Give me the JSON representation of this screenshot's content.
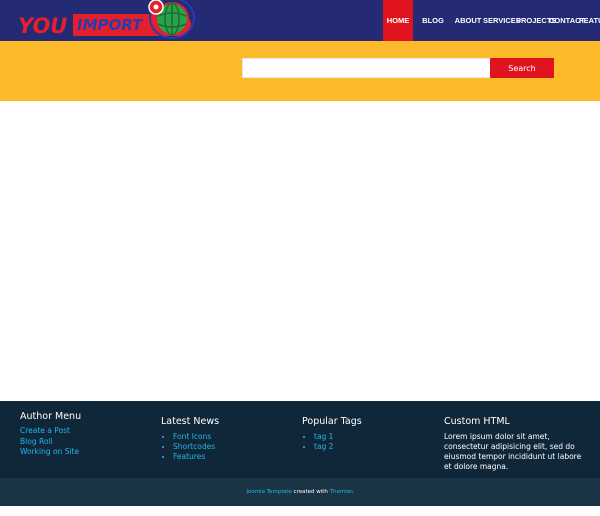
{
  "logo": {
    "part1": "YOU",
    "part2": "IMPORT"
  },
  "nav": {
    "items": [
      {
        "label": "HOME",
        "active": true
      },
      {
        "label": "BLOG"
      },
      {
        "label": "ABOUT"
      },
      {
        "label": "SERVICES"
      },
      {
        "label": "PROJECTS"
      },
      {
        "label": "CONTACT"
      },
      {
        "label": "FEATU"
      }
    ]
  },
  "search": {
    "value": "",
    "button_label": "Search"
  },
  "footer": {
    "author_menu": {
      "title": "Author Menu",
      "links": [
        "Create a Post",
        "Blog Roll",
        "Working on Site"
      ]
    },
    "latest_news": {
      "title": "Latest News",
      "items": [
        "Font Icons",
        "Shortcodes",
        "Features"
      ]
    },
    "popular_tags": {
      "title": "Popular Tags",
      "items": [
        "tag 1",
        "tag 2"
      ]
    },
    "custom_html": {
      "title": "Custom HTML",
      "text": "Lorem ipsum dolor sit amet, consectetur adipisicing elit, sed do eiusmod tempor incididunt ut labore et dolore magna."
    },
    "credits": {
      "link1": "Joomla Template",
      "middle": " created with ",
      "link2": "Themler",
      "end": "."
    }
  },
  "colors": {
    "header_bg": "#242a74",
    "accent_red": "#e0141e",
    "search_band": "#fdbb2b",
    "footer_bg": "#10273a",
    "link_blue": "#22b7e8"
  }
}
